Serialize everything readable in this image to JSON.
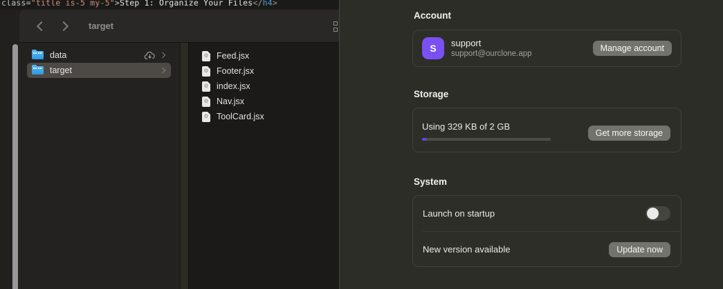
{
  "code_line": {
    "attr_name": "class=",
    "attr_value": "\"title is-5 my-5\"",
    "bracket1": ">",
    "inner_text": "Step 1: Organize Your Files",
    "close_start": "</",
    "tag_name": "h4",
    "close_end": ">"
  },
  "finder": {
    "toolbar_title": "target",
    "sidebar_items": [
      {
        "label": "data"
      },
      {
        "label": "target"
      }
    ],
    "files": [
      {
        "name": "Feed.jsx"
      },
      {
        "name": "Footer.jsx"
      },
      {
        "name": "index.jsx"
      },
      {
        "name": "Nav.jsx"
      },
      {
        "name": "ToolCard.jsx"
      }
    ]
  },
  "settings": {
    "account": {
      "heading": "Account",
      "avatar_letter": "S",
      "avatar_color": "#7b50f2",
      "name": "support",
      "email": "support@ourclone.app",
      "button_label": "Manage account"
    },
    "storage": {
      "heading": "Storage",
      "usage_text": "Using 329 KB of 2 GB",
      "button_label": "Get more storage",
      "progress_fill_color": "#5b45e8"
    },
    "system": {
      "heading": "System",
      "row1_label": "Launch on startup",
      "launch_toggle_on": false,
      "row2_label": "New version available",
      "update_button_label": "Update now"
    }
  }
}
